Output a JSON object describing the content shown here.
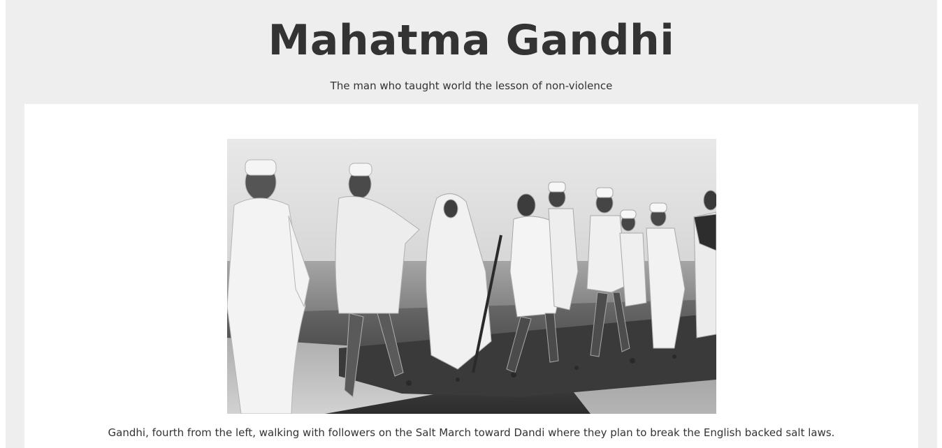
{
  "header": {
    "title": "Mahatma Gandhi",
    "tagline": "The man who taught world the lesson of non-violence"
  },
  "figure": {
    "image_label": "Black and white photograph of Gandhi and followers on the Salt March",
    "caption": "Gandhi, fourth from the left, walking with followers on the Salt March toward Dandi where they plan to break the English backed salt laws."
  },
  "colors": {
    "page_background": "#eeeeee",
    "card_background": "#ffffff",
    "text": "#333333"
  }
}
